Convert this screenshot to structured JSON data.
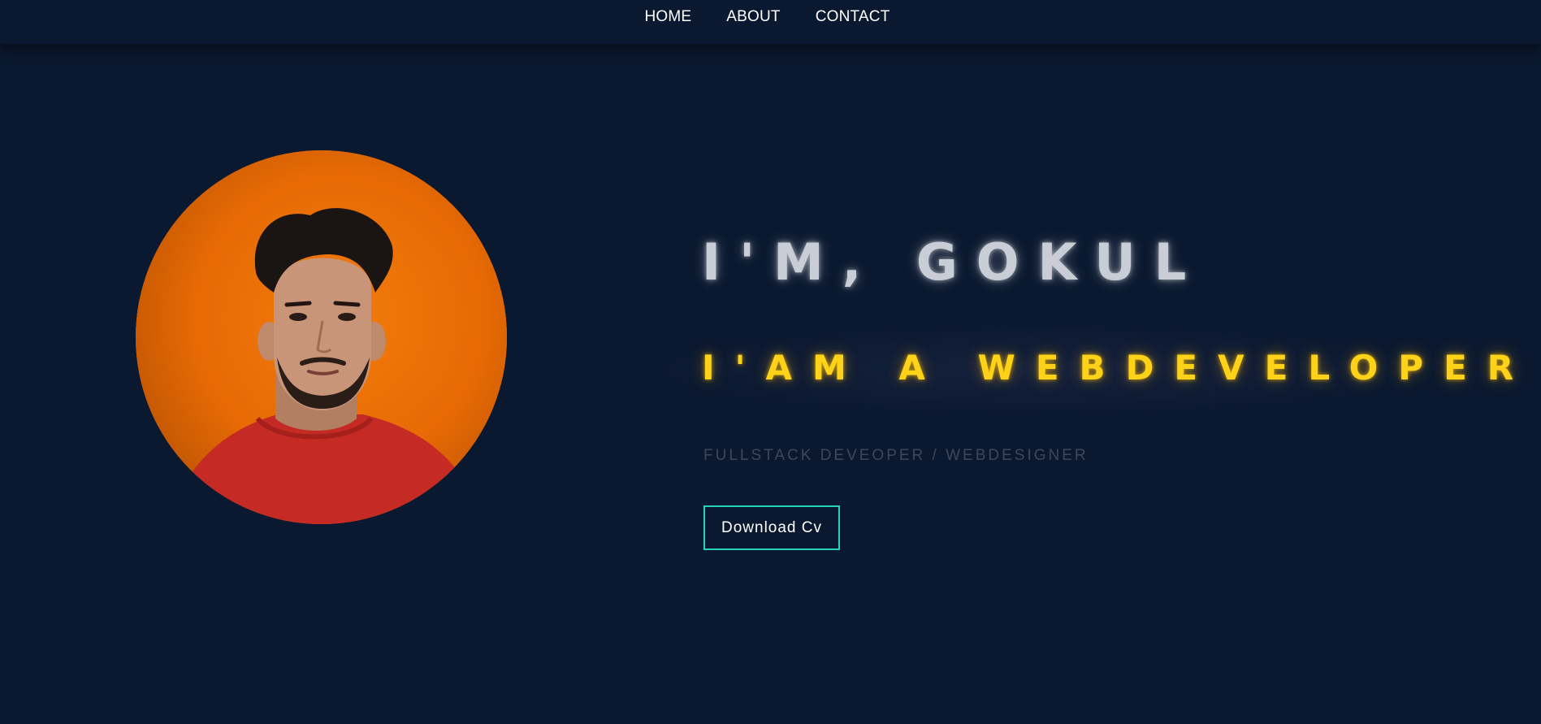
{
  "nav": {
    "items": [
      {
        "label": "HOME"
      },
      {
        "label": "ABOUT"
      },
      {
        "label": "CONTACT"
      }
    ]
  },
  "hero": {
    "title": "I'M, GOKUL",
    "role": "I'AM A WEBDEVELOPER",
    "subtitle": "FULLSTACK DEVEOPER / WEBDESIGNER",
    "cv_button": "Download Cv"
  },
  "colors": {
    "background": "#0b1930",
    "accent_border": "#22d3b4",
    "role_text": "#ffd21a",
    "avatar_bg": "#e86c05"
  }
}
